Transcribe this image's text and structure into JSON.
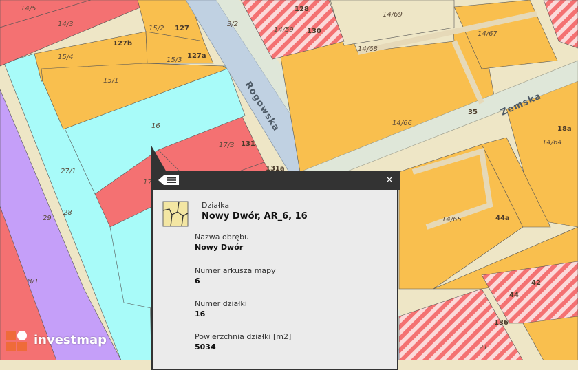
{
  "map": {
    "streets": {
      "rogowska": "Rogowska",
      "zemska": "Zemska"
    },
    "plots": {
      "p14_5": "14/5",
      "p14_3": "14/3",
      "p15_4": "15/4",
      "p15_2": "15/2",
      "p15_3": "15/3",
      "p15_1": "15/1",
      "p16": "16",
      "p17_3": "17/3",
      "p17": "17",
      "p27_1": "27/1",
      "p28": "28",
      "p29": "29",
      "p8_1": "8/1",
      "p3_2": "3/2",
      "p14_59": "14/59",
      "p14_69": "14/69",
      "p14_68": "14/68",
      "p14_67": "14/67",
      "p14_66": "14/66",
      "p14_64": "14/64",
      "p14_65": "14/65",
      "p21": "21"
    },
    "addresses": {
      "a128": "128",
      "a130": "130",
      "a127": "127",
      "a127b": "127b",
      "a127a": "127a",
      "a131": "131",
      "a131a": "131a",
      "a35": "35",
      "a18a": "18a",
      "a44a": "44a",
      "a42": "42",
      "a44": "44",
      "a136": "136"
    }
  },
  "popup": {
    "kind": "Działka",
    "title": "Nowy Dwór, AR_6, 16",
    "fields": [
      {
        "label": "Nazwa obrębu",
        "value": "Nowy Dwór"
      },
      {
        "label": "Numer arkusza mapy",
        "value": "6"
      },
      {
        "label": "Numer działki",
        "value": "16"
      },
      {
        "label": "Powierzchnia działki [m2]",
        "value": "5034"
      }
    ]
  },
  "branding": {
    "logo_text": "investmap"
  },
  "colors": {
    "residential": "#f9bf4e",
    "commercial": "#f47172",
    "green_public": "#a8fbf9",
    "services": "#c59ff9",
    "road": "#c0d1e2",
    "popup_header": "#333333",
    "logo_orange": "#ef6b3a"
  }
}
